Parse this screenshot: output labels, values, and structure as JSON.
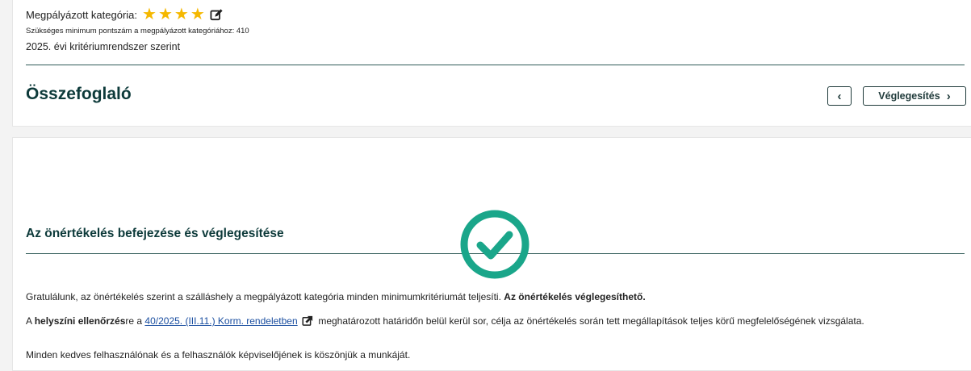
{
  "header": {
    "category_label": "Megpályázott kategória:",
    "stars": 4,
    "min_points_text": "Szükséges minimum pontszám a megpályázott kategóriához: 410",
    "system_text": "2025. évi kritériumrendszer szerint"
  },
  "summary": {
    "title": "Összefoglaló",
    "prev_label": "‹",
    "finalize_label": "Véglegesítés"
  },
  "section": {
    "title": "Az önértékelés befejezése és véglegesítése",
    "congrats_text": "Gratulálunk, az önértékelés szerint a szálláshely a megpályázott kategória minden minimumkritériumát teljesíti.",
    "congrats_bold": "Az önértékelés véglegesíthető.",
    "p2_prefix": "A ",
    "p2_bold": "helyszíni ellenőrzés",
    "p2_mid": "re a ",
    "p2_link": "40/2025. (III.11.) Korm. rendeletben",
    "p2_suffix": " meghatározott határidőn belül kerül sor, célja az önértékelés során tett megállapítások teljes körű megfelelőségének vizsgálata.",
    "p3_partial": "Minden kedves felhasználónak és a felhasználók képviselőjének is köszönjük a munkáját."
  },
  "colors": {
    "accent": "#1aa68a",
    "star": "#f5b800",
    "heading": "#0d3a3a",
    "link": "#1a4ea0"
  }
}
